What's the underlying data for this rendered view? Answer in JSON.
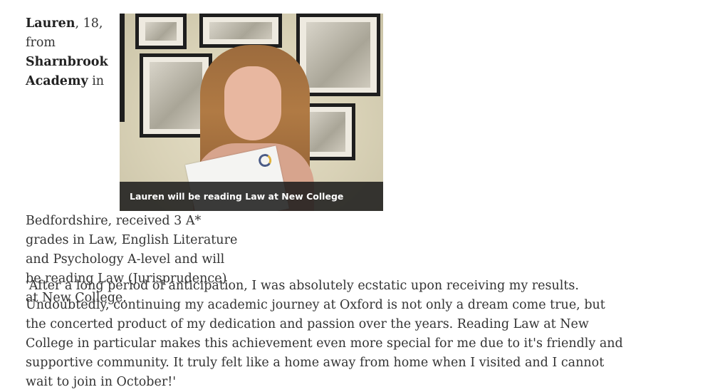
{
  "intro": {
    "name": "Lauren",
    "age_text": ", 18, from ",
    "school": "Sharnbrook Academy",
    "details": " in Bedfordshire, received 3 A* grades in Law, English Literature and Psychology A-level and will be reading Law (Jurisprudence) at New College."
  },
  "photo": {
    "caption": "Lauren will be reading Law at New College"
  },
  "quote": {
    "text": "'After a long period of anticipation, I was absolutely ecstatic upon receiving my results. Undoubtedly, continuing my academic journey at Oxford is not only a dream come true, but the concerted product of my dedication and passion over the years. Reading Law at New College in particular makes this achievement even more special for me due to it's friendly and supportive community. It truly felt like a home away from home when I visited and I cannot wait to join in October!'"
  }
}
